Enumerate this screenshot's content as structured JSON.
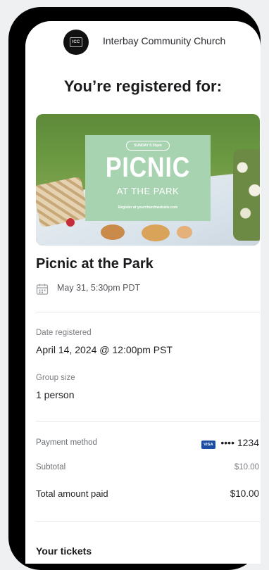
{
  "header": {
    "logo_text": "ICC",
    "church_name": "Interbay Community Church"
  },
  "page": {
    "heading": "You’re registered for:"
  },
  "banner": {
    "badge": "SUNDAY 5:30pm",
    "title": "PICNIC",
    "subtitle": "AT THE PARK",
    "register_line": "Register at yourchurchwebsite.com"
  },
  "event": {
    "title": "Picnic at the Park",
    "date": "May 31, 5:30pm PDT",
    "icon": "calendar-icon"
  },
  "details": {
    "date_registered_label": "Date registered",
    "date_registered_value": "April 14, 2024 @ 12:00pm PST",
    "group_size_label": "Group size",
    "group_size_value": "1 person"
  },
  "payment": {
    "method_label": "Payment method",
    "card_brand": "VISA",
    "card_number": "•••• 1234",
    "subtotal_label": "Subtotal",
    "subtotal_value": "$10.00",
    "total_label": "Total amount paid",
    "total_value": "$10.00"
  },
  "tickets": {
    "heading": "Your tickets"
  },
  "colors": {
    "banner_card": "#a8d3b1",
    "visa_blue": "#1a4ea3",
    "frame": "#000000"
  }
}
